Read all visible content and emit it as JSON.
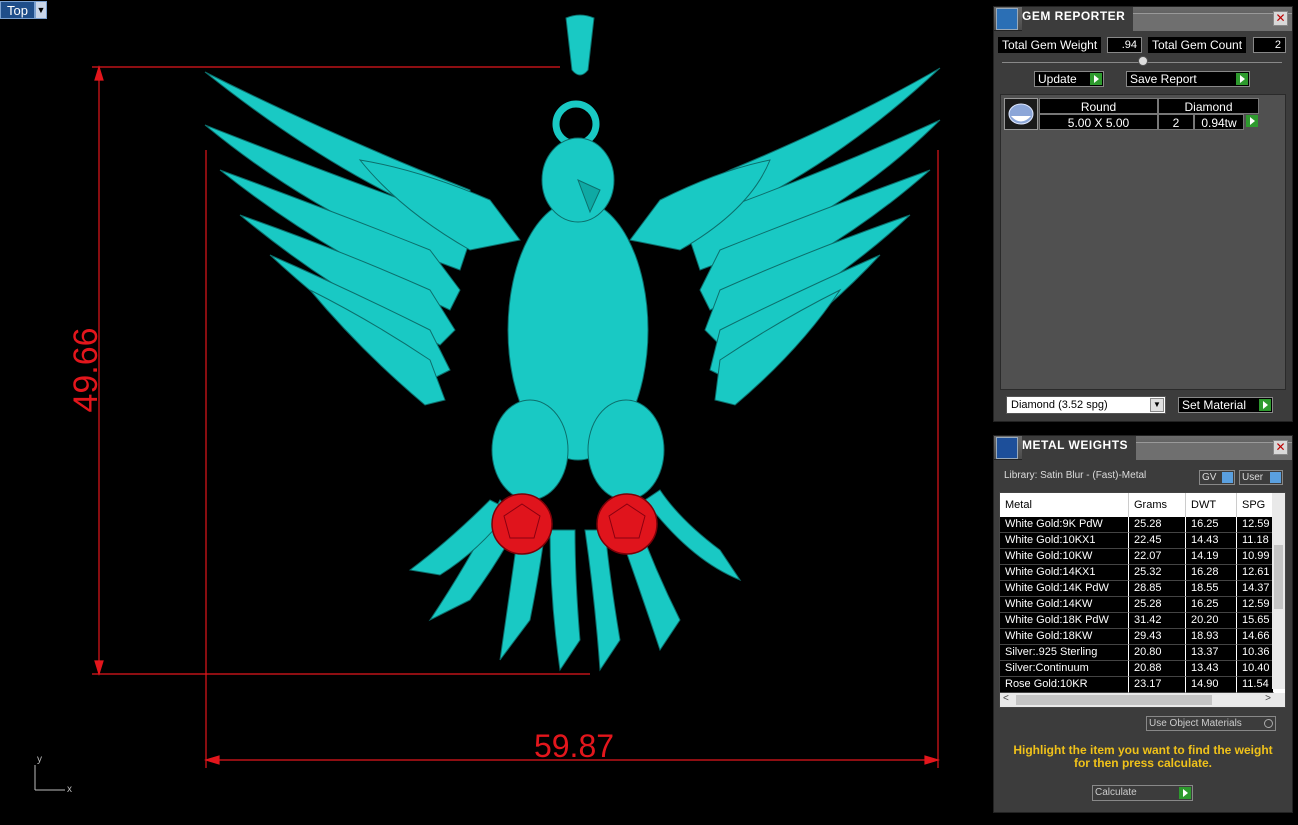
{
  "viewport": {
    "name": "Top",
    "dimension_height": "49.66",
    "dimension_width": "59.87",
    "axis_y": "y",
    "axis_x": "x"
  },
  "gem_reporter": {
    "title": "GEM REPORTER",
    "total_weight_label": "Total Gem Weight",
    "total_weight_value": ".94",
    "total_count_label": "Total Gem Count",
    "total_count_value": "2",
    "update_label": "Update",
    "save_report_label": "Save Report",
    "gem_row": {
      "shape": "Round",
      "material": "Diamond",
      "size": "5.00 X 5.00",
      "count": "2",
      "weight": "0.94tw"
    },
    "material_select": "Diamond    (3.52 spg)",
    "set_material_label": "Set Material"
  },
  "metal_weights": {
    "title": "METAL WEIGHTS",
    "library": "Library: Satin Blur - (Fast)-Metal",
    "gv_label": "GV",
    "user_label": "User",
    "columns": [
      "Metal",
      "Grams",
      "DWT",
      "SPG"
    ],
    "rows": [
      [
        "White Gold:9K PdW",
        "25.28",
        "16.25",
        "12.59"
      ],
      [
        "White Gold:10KX1",
        "22.45",
        "14.43",
        "11.18"
      ],
      [
        "White Gold:10KW",
        "22.07",
        "14.19",
        "10.99"
      ],
      [
        "White Gold:14KX1",
        "25.32",
        "16.28",
        "12.61"
      ],
      [
        "White Gold:14K PdW",
        "28.85",
        "18.55",
        "14.37"
      ],
      [
        "White Gold:14KW",
        "25.28",
        "16.25",
        "12.59"
      ],
      [
        "White Gold:18K PdW",
        "31.42",
        "20.20",
        "15.65"
      ],
      [
        "White Gold:18KW",
        "29.43",
        "18.93",
        "14.66"
      ],
      [
        "Silver:.925 Sterling",
        "20.80",
        "13.37",
        "10.36"
      ],
      [
        "Silver:Continuum",
        "20.88",
        "13.43",
        "10.40"
      ],
      [
        "Rose Gold:10KR",
        "23.17",
        "14.90",
        "11.54"
      ]
    ],
    "use_object_materials": "Use Object Materials",
    "hint": "Highlight the item you want to find the weight for then press calculate.",
    "calculate_label": "Calculate"
  },
  "colors": {
    "model": "#19c9c4",
    "gem": "#e0141c",
    "dimension": "#e3161c",
    "accent_green": "#2e9a2e",
    "hint_yellow": "#f0c21a"
  }
}
